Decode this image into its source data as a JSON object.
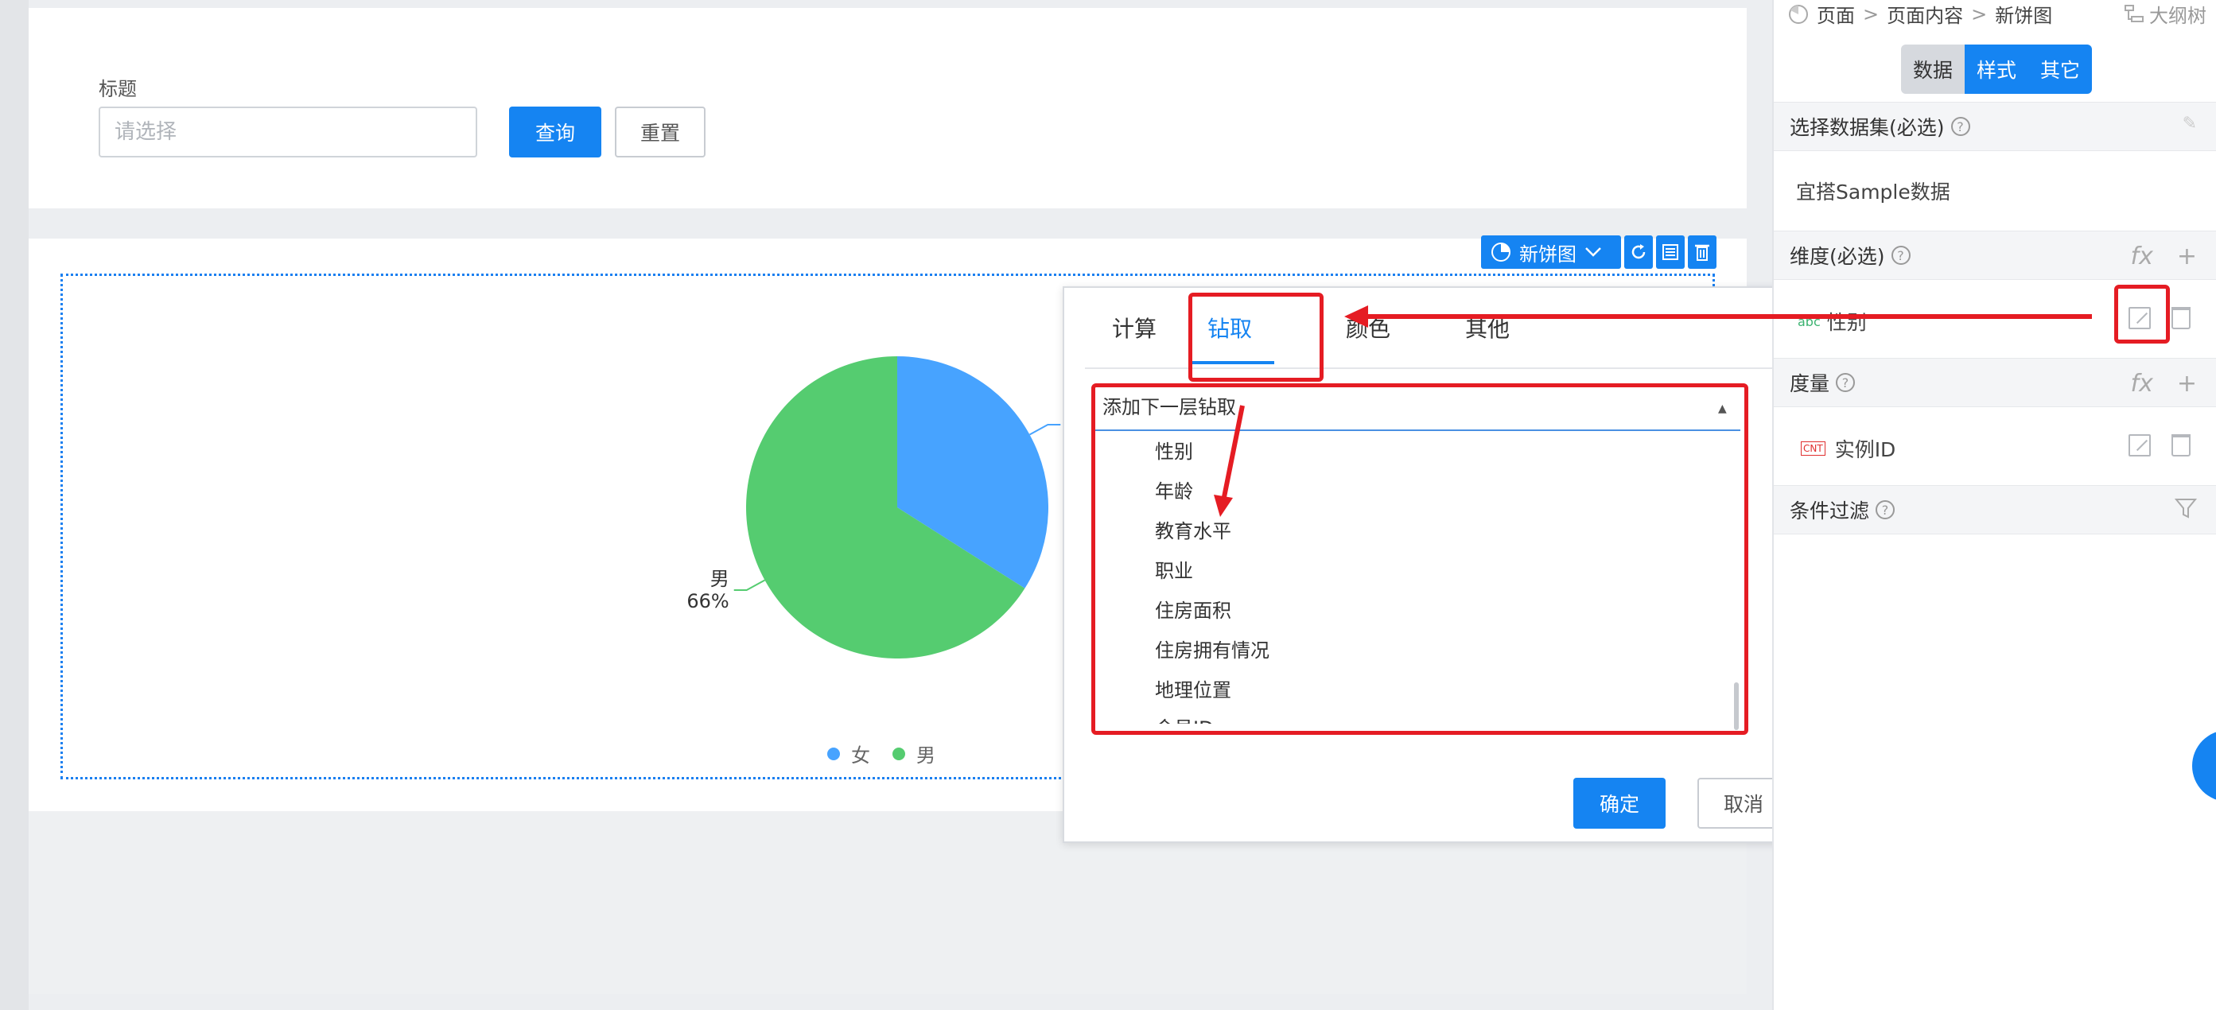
{
  "filter": {
    "label": "标题",
    "placeholder": "请选择",
    "query_label": "查询",
    "reset_label": "重置"
  },
  "widget": {
    "name": "新饼图",
    "icons": [
      "pie-chart-icon",
      "chevron-down-icon",
      "refresh-icon",
      "table-icon",
      "trash-icon"
    ]
  },
  "chart_data": {
    "type": "pie",
    "slices": [
      {
        "label": "女",
        "value": 34,
        "display": "34%",
        "color": "#47a3ff"
      },
      {
        "label": "男",
        "value": 66,
        "display": "66%",
        "color": "#55cc70"
      }
    ],
    "legend": [
      "女",
      "男"
    ],
    "legend_position": "bottom"
  },
  "dialog": {
    "tabs": [
      "计算",
      "钻取",
      "颜色",
      "其他"
    ],
    "active_tab": "钻取",
    "select_label": "添加下一层钻取",
    "options": [
      "性别",
      "年龄",
      "教育水平",
      "职业",
      "住房面积",
      "住房拥有情况",
      "地理位置",
      "会员ID"
    ],
    "ok_label": "确定",
    "cancel_label": "取消"
  },
  "panel": {
    "breadcrumb": [
      "页面",
      "页面内容",
      "新饼图"
    ],
    "breadcrumb_sep": ">",
    "outline_label": "大纲树",
    "segments": [
      "数据",
      "样式",
      "其它"
    ],
    "dataset_header": "选择数据集(必选)",
    "dataset_value": "宜搭Sample数据",
    "dimension_header": "维度(必选)",
    "dimension_field": "性别",
    "dimension_badge": "abc",
    "measure_header": "度量",
    "measure_field": "实例ID",
    "measure_badge": "CNT",
    "filter_header": "条件过滤"
  },
  "colors": {
    "accent": "#1584f2",
    "annotation": "#e51c23",
    "pie_female": "#47a3ff",
    "pie_male": "#55cc70"
  }
}
